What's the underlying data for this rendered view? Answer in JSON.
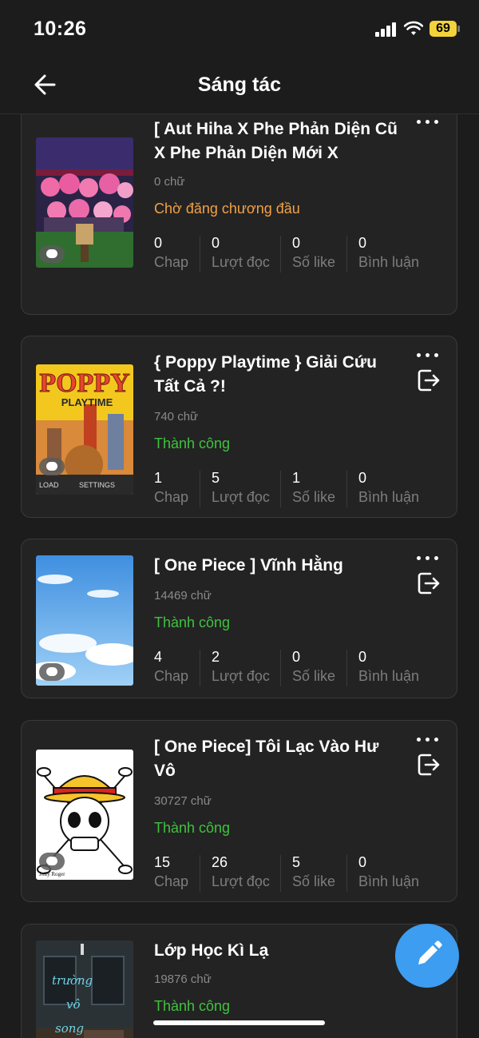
{
  "status_bar": {
    "time": "10:26",
    "battery": "69"
  },
  "header": {
    "title": "Sáng tác"
  },
  "stat_labels": {
    "chap": "Chap",
    "views": "Lượt đọc",
    "likes": "Số like",
    "comments": "Bình luận"
  },
  "stories": [
    {
      "title": "[ Aut Hiha X Phe Phản Diện Cũ X Phe Phản Diện Mới X",
      "words": "0 chữ",
      "status": "Chờ đăng chương đầu",
      "chap": "0",
      "views": "0",
      "likes": "0",
      "comments": "0"
    },
    {
      "title": "{ Poppy Playtime } Giải Cứu Tất Cả ?!",
      "words": "740 chữ",
      "status": "Thành công",
      "chap": "1",
      "views": "5",
      "likes": "1",
      "comments": "0",
      "cover_text": [
        "POPPY",
        "PLAYTIME",
        "LOAD",
        "SETTINGS"
      ]
    },
    {
      "title": "[ One Piece ] Vĩnh Hằng",
      "words": "14469 chữ",
      "status": "Thành công",
      "chap": "4",
      "views": "2",
      "likes": "0",
      "comments": "0"
    },
    {
      "title": "[ One Piece] Tôi Lạc Vào Hư Vô",
      "words": "30727 chữ",
      "status": "Thành công",
      "chap": "15",
      "views": "26",
      "likes": "5",
      "comments": "0",
      "cover_text": [
        "Jolly Roger"
      ]
    },
    {
      "title": "Lớp Học Kì Lạ",
      "words": "19876 chữ",
      "status": "Thành công",
      "cover_text": [
        "trường",
        "vô",
        "song"
      ]
    }
  ],
  "colors": {
    "pending": "#f2a145",
    "success": "#3fc23f",
    "fab": "#3d9df0",
    "background": "#1c1c1c",
    "card": "#232323"
  },
  "icons": {
    "back": "arrow-left-icon",
    "more": "more-horizontal-icon",
    "exit": "exit-icon",
    "fab": "pencil-icon"
  }
}
